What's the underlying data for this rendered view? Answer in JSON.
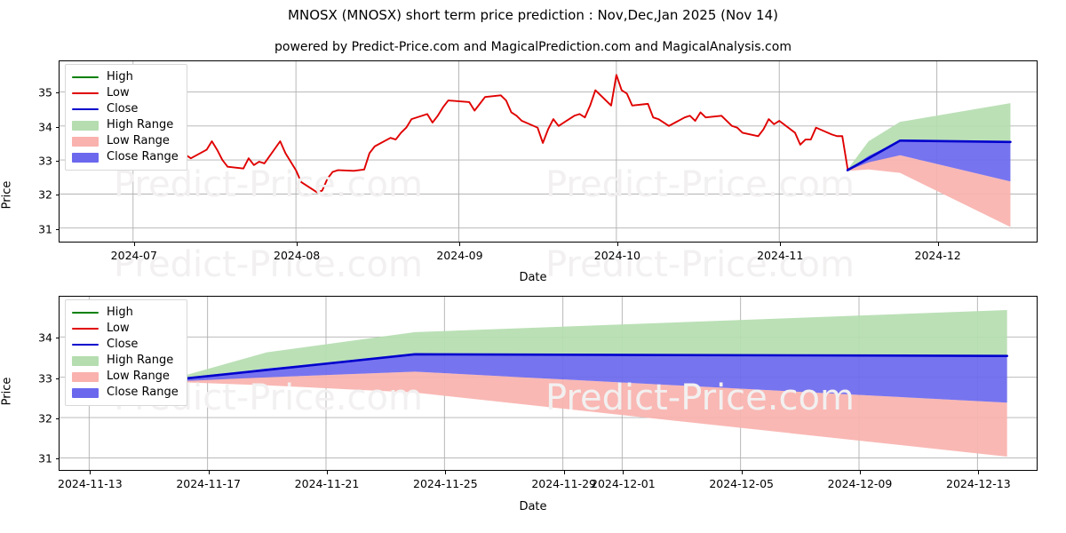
{
  "header": {
    "title": "MNOSX (MNOSX) short term price prediction : Nov,Dec,Jan 2025 (Nov 14)",
    "subtitle": "powered by Predict-Price.com and MagicalPrediction.com and MagicalAnalysis.com"
  },
  "watermark": {
    "text": "Predict-Price.com"
  },
  "legend": {
    "items": [
      {
        "label": "High",
        "type": "line",
        "color": "#008000"
      },
      {
        "label": "Low",
        "type": "line",
        "color": "#e00000"
      },
      {
        "label": "Close",
        "type": "line",
        "color": "#0000cd"
      },
      {
        "label": "High Range",
        "type": "patch",
        "color": "#b5ddb0"
      },
      {
        "label": "Low Range",
        "type": "patch",
        "color": "#f9b2ae"
      },
      {
        "label": "Close Range",
        "type": "patch",
        "color": "#6b68ee"
      }
    ]
  },
  "chart_data": [
    {
      "id": "overview",
      "type": "line",
      "title": "MNOSX (MNOSX) short term price prediction : Nov,Dec,Jan 2025 (Nov 14)",
      "xlabel": "Date",
      "ylabel": "Price",
      "ylim": [
        30.6,
        35.9
      ],
      "yticks": [
        31,
        32,
        33,
        34,
        35
      ],
      "xlim": [
        "2024-06-17",
        "2024-12-20"
      ],
      "xticks": [
        "2024-07",
        "2024-08",
        "2024-09",
        "2024-10",
        "2024-11",
        "2024-12"
      ],
      "grid": true,
      "legend_position": "upper left",
      "series": [
        {
          "name": "Low",
          "color": "#e00000",
          "x": [
            "2024-06-21",
            "2024-06-24",
            "2024-06-25",
            "2024-06-26",
            "2024-06-27",
            "2024-06-28",
            "2024-07-01",
            "2024-07-02",
            "2024-07-03",
            "2024-07-05",
            "2024-07-08",
            "2024-07-09",
            "2024-07-10",
            "2024-07-11",
            "2024-07-12",
            "2024-07-15",
            "2024-07-16",
            "2024-07-17",
            "2024-07-18",
            "2024-07-19",
            "2024-07-22",
            "2024-07-23",
            "2024-07-24",
            "2024-07-25",
            "2024-07-26",
            "2024-07-29",
            "2024-07-30",
            "2024-07-31",
            "2024-08-01",
            "2024-08-02",
            "2024-08-05",
            "2024-08-06",
            "2024-08-07",
            "2024-08-08",
            "2024-08-09",
            "2024-08-12",
            "2024-08-13",
            "2024-08-14",
            "2024-08-15",
            "2024-08-16",
            "2024-08-19",
            "2024-08-20",
            "2024-08-21",
            "2024-08-22",
            "2024-08-23",
            "2024-08-26",
            "2024-08-27",
            "2024-08-28",
            "2024-08-29",
            "2024-08-30",
            "2024-09-03",
            "2024-09-04",
            "2024-09-05",
            "2024-09-06",
            "2024-09-09",
            "2024-09-10",
            "2024-09-11",
            "2024-09-12",
            "2024-09-13",
            "2024-09-16",
            "2024-09-17",
            "2024-09-18",
            "2024-09-19",
            "2024-09-20",
            "2024-09-23",
            "2024-09-24",
            "2024-09-25",
            "2024-09-26",
            "2024-09-27",
            "2024-09-30",
            "2024-10-01",
            "2024-10-02",
            "2024-10-03",
            "2024-10-04",
            "2024-10-07",
            "2024-10-08",
            "2024-10-09",
            "2024-10-10",
            "2024-10-11",
            "2024-10-14",
            "2024-10-15",
            "2024-10-16",
            "2024-10-17",
            "2024-10-18",
            "2024-10-21",
            "2024-10-22",
            "2024-10-23",
            "2024-10-24",
            "2024-10-25",
            "2024-10-28",
            "2024-10-29",
            "2024-10-30",
            "2024-10-31",
            "2024-11-01",
            "2024-11-04",
            "2024-11-05",
            "2024-11-06",
            "2024-11-07",
            "2024-11-08",
            "2024-11-11",
            "2024-11-12",
            "2024-11-13",
            "2024-11-14"
          ],
          "values": [
            33.1,
            33.4,
            33.55,
            33.6,
            33.45,
            33.75,
            33.95,
            33.92,
            33.75,
            33.9,
            33.55,
            33.95,
            33.6,
            33.15,
            33.05,
            33.3,
            33.55,
            33.3,
            33.0,
            32.8,
            32.75,
            33.05,
            32.85,
            32.95,
            32.9,
            33.55,
            33.2,
            32.95,
            32.7,
            32.35,
            32.05,
            32.1,
            32.45,
            32.65,
            32.7,
            32.68,
            32.7,
            32.72,
            33.2,
            33.4,
            33.65,
            33.6,
            33.8,
            33.95,
            34.2,
            34.35,
            34.1,
            34.3,
            34.55,
            34.75,
            34.7,
            34.45,
            34.65,
            34.85,
            34.9,
            34.75,
            34.4,
            34.3,
            34.15,
            33.95,
            33.5,
            33.9,
            34.2,
            34.0,
            34.3,
            34.35,
            34.25,
            34.6,
            35.05,
            34.6,
            35.5,
            35.05,
            34.95,
            34.6,
            34.65,
            34.25,
            34.2,
            34.1,
            34.0,
            34.25,
            34.3,
            34.15,
            34.4,
            34.25,
            34.3,
            34.15,
            34.0,
            33.95,
            33.8,
            33.7,
            33.9,
            34.2,
            34.05,
            34.15,
            33.8,
            33.45,
            33.6,
            33.6,
            33.95,
            33.75,
            33.7,
            33.7,
            32.75,
            32.7
          ]
        },
        {
          "name": "Close",
          "color": "#0000cd",
          "x": [
            "2024-11-14",
            "2024-11-24",
            "2024-12-15"
          ],
          "values": [
            32.7,
            33.57,
            33.53
          ]
        }
      ],
      "bands": [
        {
          "name": "High Range",
          "color": "#b5ddb0",
          "x": [
            "2024-11-14",
            "2024-11-18",
            "2024-11-24",
            "2024-12-15"
          ],
          "upper": [
            32.72,
            33.55,
            34.12,
            34.67
          ],
          "lower": [
            32.7,
            33.1,
            33.58,
            33.53
          ]
        },
        {
          "name": "Low Range",
          "color": "#f9b2ae",
          "x": [
            "2024-11-14",
            "2024-11-18",
            "2024-11-24",
            "2024-12-15"
          ],
          "upper": [
            32.7,
            32.95,
            33.14,
            32.37
          ],
          "lower": [
            32.68,
            32.72,
            32.62,
            31.03
          ]
        },
        {
          "name": "Close Range",
          "color": "#6b68ee",
          "x": [
            "2024-11-14",
            "2024-11-18",
            "2024-11-24",
            "2024-12-15"
          ],
          "upper": [
            32.7,
            33.12,
            33.57,
            33.53
          ],
          "lower": [
            32.69,
            32.93,
            33.14,
            32.37
          ]
        }
      ]
    },
    {
      "id": "forecast-zoom",
      "type": "line",
      "xlabel": "Date",
      "ylabel": "Price",
      "ylim": [
        30.7,
        35.0
      ],
      "yticks": [
        31,
        32,
        33,
        34
      ],
      "xlim": [
        "2024-11-12",
        "2024-12-15"
      ],
      "xticks": [
        "2024-11-13",
        "2024-11-17",
        "2024-11-21",
        "2024-11-25",
        "2024-11-29",
        "2024-12-01",
        "2024-12-05",
        "2024-12-09",
        "2024-12-13"
      ],
      "grid": true,
      "legend_position": "upper left",
      "series": [
        {
          "name": "Close",
          "color": "#0000cd",
          "x": [
            "2024-11-16",
            "2024-11-24",
            "2024-12-14"
          ],
          "values": [
            32.95,
            33.57,
            33.53
          ]
        }
      ],
      "bands": [
        {
          "name": "High Range",
          "color": "#b5ddb0",
          "x": [
            "2024-11-16",
            "2024-11-19",
            "2024-11-24",
            "2024-12-14"
          ],
          "upper": [
            33.0,
            33.62,
            34.12,
            34.67
          ],
          "lower": [
            32.95,
            33.22,
            33.57,
            33.53
          ]
        },
        {
          "name": "Low Range",
          "color": "#f9b2ae",
          "x": [
            "2024-11-16",
            "2024-11-19",
            "2024-11-24",
            "2024-12-14"
          ],
          "upper": [
            32.92,
            33.0,
            33.14,
            32.37
          ],
          "lower": [
            32.88,
            32.8,
            32.62,
            31.03
          ]
        },
        {
          "name": "Close Range",
          "color": "#6b68ee",
          "x": [
            "2024-11-16",
            "2024-11-19",
            "2024-11-24",
            "2024-12-14"
          ],
          "upper": [
            32.95,
            33.22,
            33.57,
            33.53
          ],
          "lower": [
            32.9,
            33.0,
            33.14,
            32.37
          ]
        }
      ]
    }
  ]
}
